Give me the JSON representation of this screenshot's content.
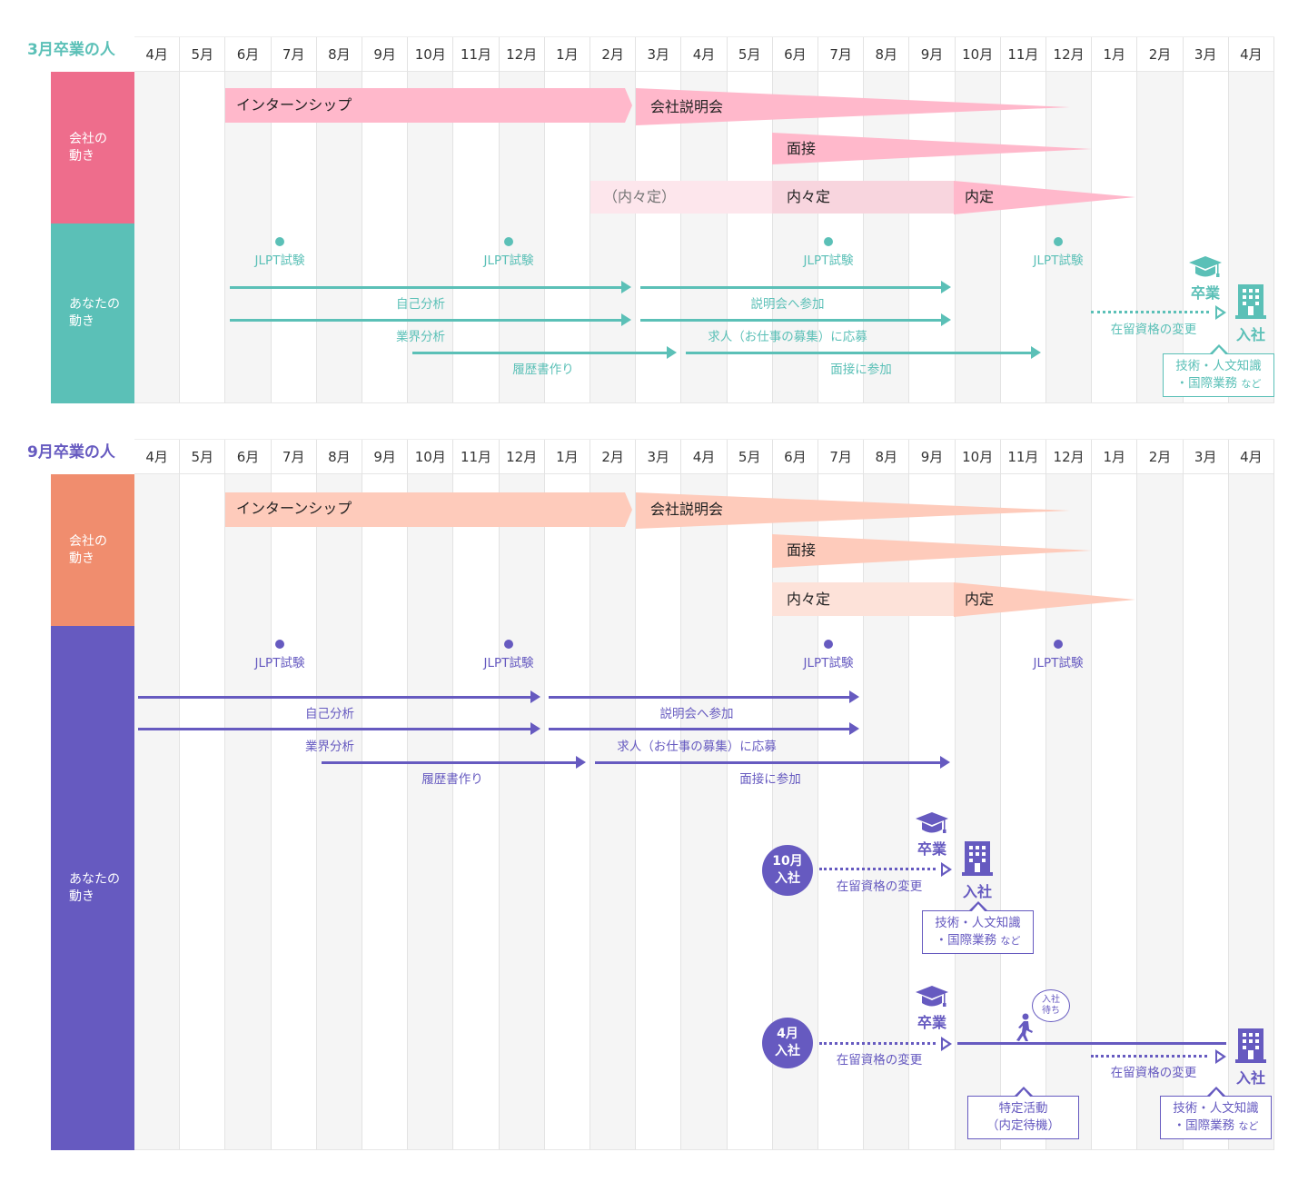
{
  "months": [
    "4月",
    "5月",
    "6月",
    "7月",
    "8月",
    "9月",
    "10月",
    "11月",
    "12月",
    "1月",
    "2月",
    "3月",
    "4月",
    "5月",
    "6月",
    "7月",
    "8月",
    "9月",
    "10月",
    "11月",
    "12月",
    "1月",
    "2月",
    "3月",
    "4月"
  ],
  "colors": {
    "teal": "#5bc0b7",
    "pink_side": "#ee6d8c",
    "pink_bar": "#ffb8cb",
    "pink_light": "#fde6ec",
    "purple": "#665ac0",
    "orange_side": "#f08d6e",
    "orange_bar": "#fecbbb",
    "orange_light": "#fde2d9"
  },
  "march": {
    "title": "3月卒業の人",
    "company_label": "会社の\n動き",
    "you_label": "あなたの\n動き",
    "bars": {
      "internship": "インターンシップ",
      "briefing": "会社説明会",
      "interview": "面接",
      "pre_offer_paren": "（内々定）",
      "pre_offer": "内々定",
      "offer": "内定"
    },
    "jlpt": "JLPT試験",
    "arrows": {
      "self_analysis": "自己分析",
      "briefing_attend": "説明会へ参加",
      "industry": "業界分析",
      "apply": "求人（お仕事の募集）に応募",
      "resume": "履歴書作り",
      "interview_attend": "面接に参加"
    },
    "graduation": "卒業",
    "visa_change": "在留資格の変更",
    "join": "入社",
    "note_line1": "技術・人文知識",
    "note_line2": "・国際業務",
    "note_suffix": "など"
  },
  "september": {
    "title": "9月卒業の人",
    "company_label": "会社の\n動き",
    "you_label": "あなたの\n動き",
    "bars": {
      "internship": "インターンシップ",
      "briefing": "会社説明会",
      "interview": "面接",
      "pre_offer": "内々定",
      "offer": "内定"
    },
    "jlpt": "JLPT試験",
    "arrows": {
      "self_analysis": "自己分析",
      "briefing_attend": "説明会へ参加",
      "industry": "業界分析",
      "apply": "求人（お仕事の募集）に応募",
      "resume": "履歴書作り",
      "interview_attend": "面接に参加"
    },
    "oct_join": {
      "badge": "10月\n入社",
      "graduation": "卒業",
      "visa_change": "在留資格の変更",
      "join": "入社",
      "note_line1": "技術・人文知識",
      "note_line2": "・国際業務",
      "note_suffix": "など"
    },
    "apr_join": {
      "badge": "4月\n入社",
      "graduation": "卒業",
      "visa_change": "在留資格の変更",
      "waiting_bubble": "入社\n待ち",
      "special_line1": "特定活動",
      "special_line2": "（内定待機）",
      "visa_change_2": "在留資格の変更",
      "join": "入社",
      "note_line1": "技術・人文知識",
      "note_line2": "・国際業務",
      "note_suffix": "など"
    }
  }
}
